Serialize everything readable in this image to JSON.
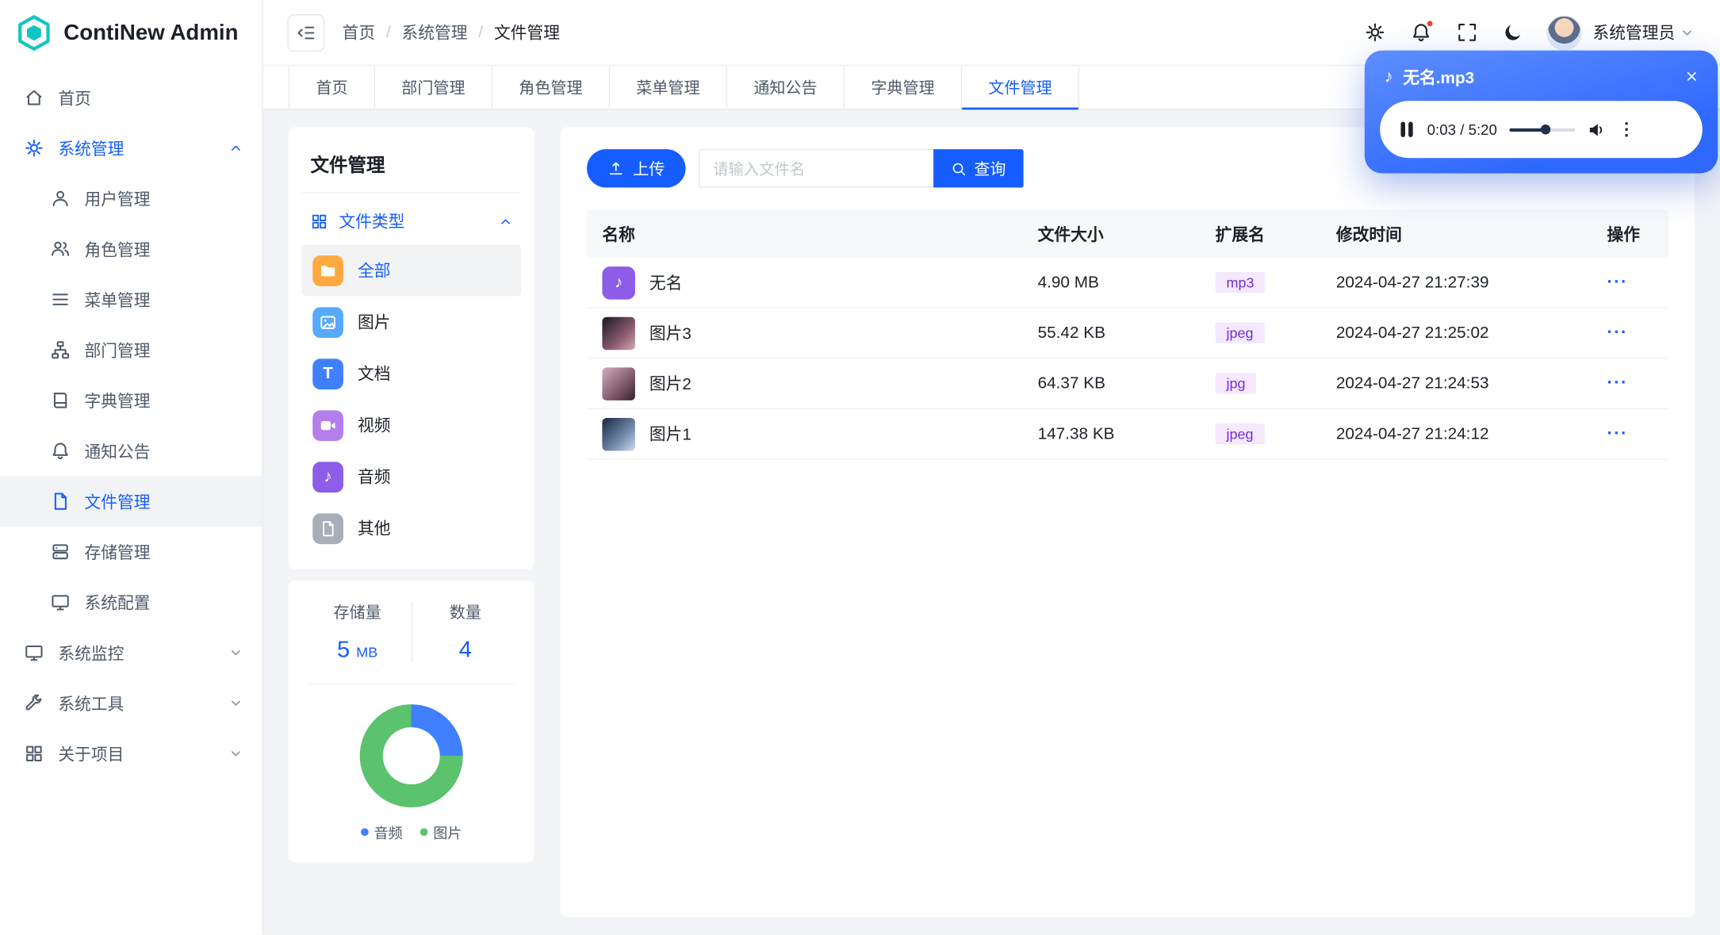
{
  "app": {
    "title": "ContiNew Admin"
  },
  "topbar": {
    "breadcrumb": [
      "首页",
      "系统管理",
      "文件管理"
    ],
    "separator": "/",
    "user_name": "系统管理员"
  },
  "tabs": {
    "items": [
      "首页",
      "部门管理",
      "角色管理",
      "菜单管理",
      "通知公告",
      "字典管理",
      "文件管理"
    ],
    "active": "文件管理"
  },
  "sidebar": {
    "home": "首页",
    "system_mgmt": "系统管理",
    "system_children": [
      "用户管理",
      "角色管理",
      "菜单管理",
      "部门管理",
      "字典管理",
      "通知公告",
      "文件管理",
      "存储管理",
      "系统配置"
    ],
    "active_item": "文件管理",
    "system_monitor": "系统监控",
    "system_tools": "系统工具",
    "about_project": "关于项目"
  },
  "file_panel": {
    "title": "文件管理",
    "group_label": "文件类型",
    "types": [
      {
        "label": "全部",
        "icon": "folder-icon",
        "color": "#ffa940",
        "active": true
      },
      {
        "label": "图片",
        "icon": "image-icon",
        "color": "#57a9fb",
        "active": false
      },
      {
        "label": "文档",
        "icon": "document-icon",
        "color": "#4080ff",
        "active": false
      },
      {
        "label": "视频",
        "icon": "video-icon",
        "color": "#b37feb",
        "active": false
      },
      {
        "label": "音频",
        "icon": "music-icon",
        "color": "#8d5ce8",
        "active": false
      },
      {
        "label": "其他",
        "icon": "file-icon",
        "color": "#a9aeb8",
        "active": false
      }
    ]
  },
  "stats": {
    "storage_label": "存储量",
    "storage_value": "5",
    "storage_unit": "MB",
    "count_label": "数量",
    "count_value": "4"
  },
  "chart_data": {
    "type": "pie",
    "donut": true,
    "title": "",
    "labels": [
      "音频",
      "图片"
    ],
    "values": [
      25,
      75
    ],
    "colors": [
      "#4080ff",
      "#5bc26d"
    ],
    "legend_position": "bottom"
  },
  "toolbar": {
    "upload_label": "上传",
    "search_placeholder": "请输入文件名",
    "query_label": "查询"
  },
  "table": {
    "columns": [
      "名称",
      "文件大小",
      "扩展名",
      "修改时间",
      "操作"
    ],
    "actions_label": "···",
    "rows": [
      {
        "name": "无名",
        "size": "4.90 MB",
        "ext": "mp3",
        "time": "2024-04-27 21:27:39",
        "kind": "audio"
      },
      {
        "name": "图片3",
        "size": "55.42 KB",
        "ext": "jpeg",
        "time": "2024-04-27 21:25:02",
        "kind": "image"
      },
      {
        "name": "图片2",
        "size": "64.37 KB",
        "ext": "jpg",
        "time": "2024-04-27 21:24:53",
        "kind": "image"
      },
      {
        "name": "图片1",
        "size": "147.38 KB",
        "ext": "jpeg",
        "time": "2024-04-27 21:24:12",
        "kind": "image"
      }
    ]
  },
  "player": {
    "title": "无名.mp3",
    "time": "0:03 / 5:20",
    "progress_percent": 55,
    "close_label": "✕"
  },
  "colors": {
    "primary": "#165dff",
    "tag_bg": "#f5e8ff",
    "tag_text": "#722ed1",
    "player_gradient_start": "#5d8eff",
    "player_gradient_end": "#2f68ff"
  }
}
